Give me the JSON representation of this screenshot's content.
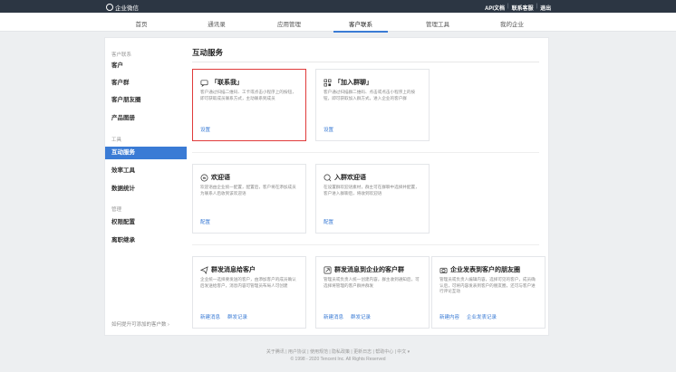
{
  "topbar": {
    "brand": "企业微信",
    "links": [
      "API文档",
      "联系客服",
      "退出"
    ]
  },
  "nav": [
    "首页",
    "通讯录",
    "应用管理",
    "客户联系",
    "管理工具",
    "我的企业"
  ],
  "sidebar": {
    "group1": "客户联系",
    "items1": [
      "客户",
      "客户群",
      "客户朋友圈",
      "产品图册"
    ],
    "group2": "工具",
    "items2": [
      "互动服务",
      "效率工具",
      "数据统计"
    ],
    "group3": "管理",
    "items3": [
      "权限配置",
      "离职继承"
    ],
    "bottom_link": "如何提升可添加的客户数 ›"
  },
  "main": {
    "title": "互动服务",
    "cards": [
      {
        "title": "「联系我」",
        "desc": "客户通过扫描二维码、工卡或点击小程序上的按钮，即可获取成员联系方式，主动联系到成员",
        "actions": [
          "设置"
        ]
      },
      {
        "title": "「加入群聊」",
        "desc": "客户通过扫描群二维码、点击或点击小程序上的按钮，即可获取加入群方式，进入企业的客户群",
        "actions": [
          "设置"
        ]
      },
      {
        "title": "欢迎语",
        "desc": "欢迎语由企业统一配置，配置后，客户将在添加成员为联系人后收到该欢迎语",
        "actions": [
          "配置"
        ]
      },
      {
        "title": "入群欢迎语",
        "desc": "在设置群欢迎语素材，群主可在群聊中选择并配置，客户进入群聊后，将收到欢迎语",
        "actions": [
          "配置"
        ]
      },
      {
        "title": "群发消息给客户",
        "desc": "企业统一选择要发送的客户，由添加客户的成员确认后发送给客户，消息内容可管理员布局人可创建",
        "actions": [
          "新建消息",
          "群发记录"
        ]
      },
      {
        "title": "群发消息到企业的客户群",
        "desc": "管理员或负责人统一创建内容，群主收到通知后，可选择将管理的客户群并群发",
        "actions": [
          "新建消息",
          "群发记录"
        ]
      },
      {
        "title": "企业发表到客户的朋友圈",
        "desc": "管理员或负责人编辑内容，选择可见的客户，成员确认后，可将内容发表到客户的朋友圈，还可与客户进行评论互动",
        "actions": [
          "新建内容",
          "企业发表记录"
        ]
      }
    ]
  },
  "footer": {
    "line1": "关于腾讯 | 用户协议 | 使用规范 | 隐私政策 | 更新日志 | 帮助中心 | 中文 ▾",
    "line2": "© 1998 - 2020 Tencent Inc. All Rights Reserved"
  }
}
